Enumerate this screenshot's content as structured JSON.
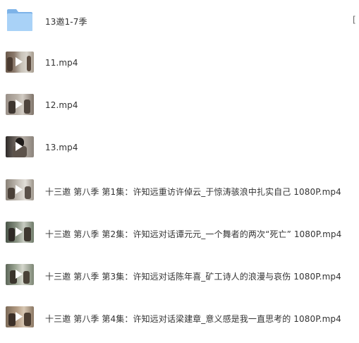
{
  "files": [
    {
      "name": "13邀1-7季",
      "type": "folder"
    },
    {
      "name": "11.mp4",
      "type": "video"
    },
    {
      "name": "12.mp4",
      "type": "video"
    },
    {
      "name": "13.mp4",
      "type": "video"
    },
    {
      "name": "十三邀 第八季 第1集：许知远重访许倬云_于惊涛骇浪中扎实自己 1080P.mp4",
      "type": "video"
    },
    {
      "name": "十三邀 第八季 第2集：许知远对话谭元元_一个舞者的两次“死亡” 1080P.mp4",
      "type": "video"
    },
    {
      "name": "十三邀 第八季 第3集：许知远对话陈年喜_矿工诗人的浪漫与哀伤 1080P.mp4",
      "type": "video"
    },
    {
      "name": "十三邀 第八季 第4集：许知远对话梁建章_意义感是我一直思考的 1080P.mp4",
      "type": "video"
    }
  ],
  "colors": {
    "folder_back": "#7db3e8",
    "folder_front": "#a9d2f7",
    "text": "#333333",
    "play": "#ffffff"
  }
}
